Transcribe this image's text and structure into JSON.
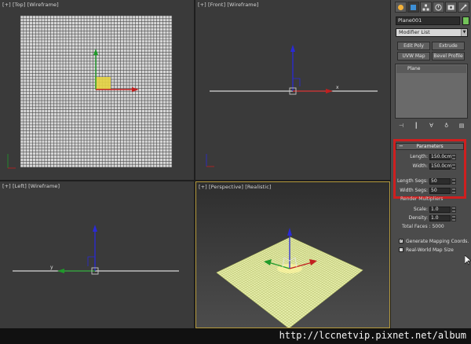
{
  "viewports": {
    "top": {
      "label_plus": "[+]",
      "label_view": "[Top]",
      "label_shade": "[Wireframe]"
    },
    "front": {
      "label_plus": "[+]",
      "label_view": "[Front]",
      "label_shade": "[Wireframe]"
    },
    "left": {
      "label_plus": "[+]",
      "label_view": "[Left]",
      "label_shade": "[Wireframe]"
    },
    "perspective": {
      "label_plus": "[+]",
      "label_view": "[Perspective]",
      "label_shade": "[Realistic]"
    }
  },
  "axis_labels": {
    "x": "x",
    "y": "y"
  },
  "command_panel": {
    "tabs": [
      "create-icon",
      "modify-icon",
      "hierarchy-icon",
      "motion-icon",
      "display-icon",
      "utilities-icon"
    ],
    "object_name": "Plane001",
    "object_color": "#73c35a",
    "modifier_list": "Modifier List",
    "buttons": {
      "edit_poly": "Edit Poly",
      "extrude": "Extrude",
      "uvw_map": "UVW Map",
      "bevel_profile": "Bevel Profile"
    },
    "stack_item": "Plane",
    "stack_tools": [
      "pin-stack-icon",
      "show-end-result-icon",
      "make-unique-icon",
      "remove-modifier-icon",
      "configure-sets-icon"
    ]
  },
  "parameters": {
    "title": "Parameters",
    "length_label": "Length:",
    "length_value": "150.0cm",
    "width_label": "Width:",
    "width_value": "150.0cm",
    "length_segs_label": "Length Segs:",
    "length_segs_value": "50",
    "width_segs_label": "Width Segs:",
    "width_segs_value": "50"
  },
  "render_multipliers": {
    "title": "Render Multipliers",
    "scale_label": "Scale:",
    "scale_value": "1.0",
    "density_label": "Density:",
    "density_value": "1.0",
    "total_faces": "Total Faces : 5000",
    "gen_mapping": "Generate Mapping Coords.",
    "gen_mapping_checked": true,
    "real_world": "Real-World Map Size",
    "real_world_checked": false
  },
  "watermark": "http://lccnetvip.pixnet.net/album"
}
